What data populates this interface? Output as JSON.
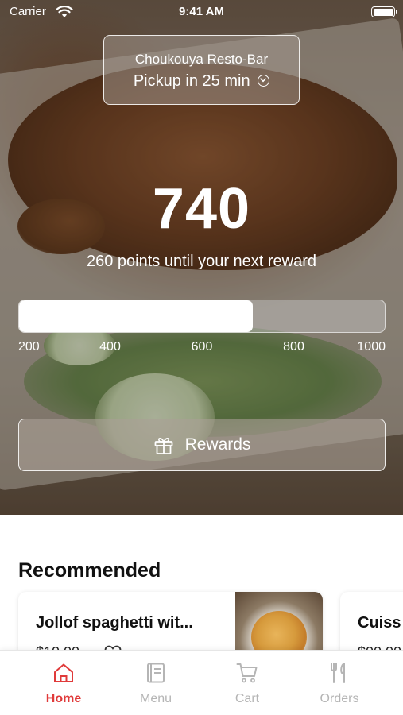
{
  "status_bar": {
    "carrier": "Carrier",
    "time": "9:41 AM"
  },
  "pickup": {
    "restaurant": "Choukouya Resto-Bar",
    "eta": "Pickup in 25 min"
  },
  "points": {
    "value": "740",
    "caption": "260 points until your next reward",
    "progress_fraction": 0.64,
    "ticks": [
      "200",
      "400",
      "600",
      "800",
      "1000"
    ]
  },
  "rewards_button": {
    "label": "Rewards"
  },
  "recommended": {
    "title": "Recommended",
    "items": [
      {
        "name": "Jollof spaghetti wit...",
        "price": "$10.00"
      },
      {
        "name": "Cuiss",
        "price": "$00.00"
      }
    ]
  },
  "tabs": [
    {
      "label": "Home",
      "icon": "home-icon",
      "active": true
    },
    {
      "label": "Menu",
      "icon": "menu-book-icon",
      "active": false
    },
    {
      "label": "Cart",
      "icon": "cart-icon",
      "active": false
    },
    {
      "label": "Orders",
      "icon": "fork-knife-icon",
      "active": false
    }
  ],
  "colors": {
    "accent": "#e03a3a",
    "inactive": "#b5b5b5"
  }
}
